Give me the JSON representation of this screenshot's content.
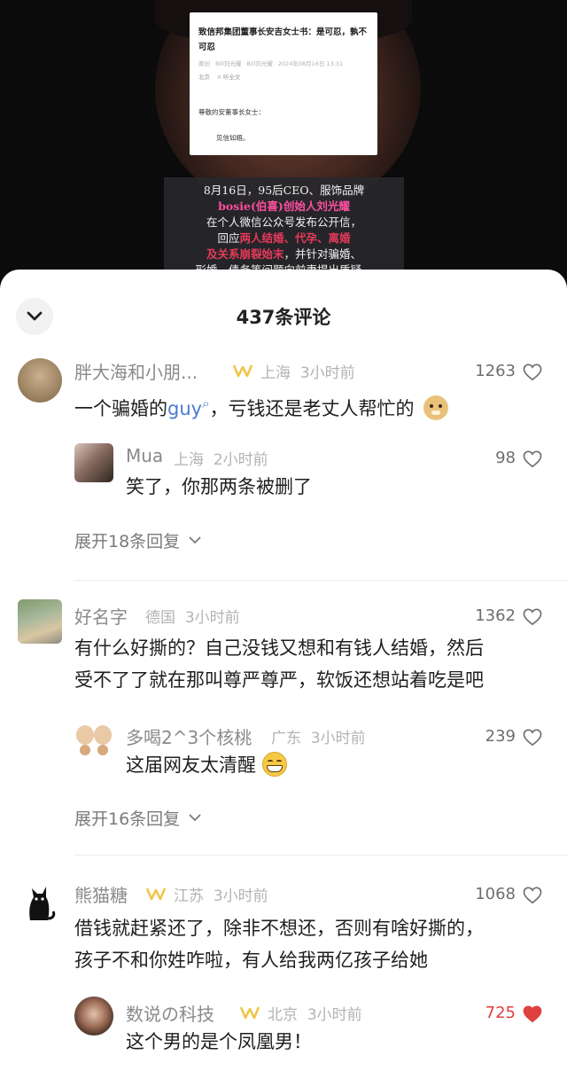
{
  "video": {
    "doc_title": "致信邦集团董事长安吉女士书：是可忍，孰不可忍",
    "doc_meta": [
      "原创",
      "Bill刘光耀",
      "Bill刘光耀",
      "2024年08月16日 13:31"
    ],
    "doc_meta2": [
      "北京",
      "听全文"
    ],
    "doc_greeting": "尊敬的安董事长女士：",
    "doc_body": "见信如晤。",
    "caption_lines": [
      {
        "parts": [
          {
            "t": "8月16日，95后CEO、服饰品牌",
            "c": ""
          }
        ]
      },
      {
        "parts": [
          {
            "t": "bosie(伯喜)创始人刘光耀",
            "c": "pink"
          }
        ]
      },
      {
        "parts": [
          {
            "t": "在个人微信公众号发布公开信，",
            "c": ""
          }
        ]
      },
      {
        "parts": [
          {
            "t": "回应",
            "c": ""
          },
          {
            "t": "两人结婚、代孕、离婚",
            "c": "red"
          }
        ]
      },
      {
        "parts": [
          {
            "t": "及关系崩裂始末",
            "c": "red"
          },
          {
            "t": "，并针对骗婚、",
            "c": ""
          }
        ]
      },
      {
        "parts": [
          {
            "t": "形婚、债务等问题向前妻提出质疑。",
            "c": ""
          }
        ]
      }
    ]
  },
  "sheet": {
    "title": "437条评论"
  },
  "comments": {
    "c1": {
      "user": "胖大海和小朋...",
      "region": "上海",
      "time": "3小时前",
      "likes": "1263",
      "text_a": "一个骗婚的",
      "text_link": "guy",
      "text_b": "，亏钱还是老丈人帮忙的"
    },
    "r1": {
      "user": "Mua",
      "region": "上海",
      "time": "2小时前",
      "likes": "98",
      "text": "笑了，你那两条被删了"
    },
    "e1": "展开18条回复",
    "c2": {
      "user": "好名字",
      "region": "德国",
      "time": "3小时前",
      "likes": "1362",
      "line1": "有什么好撕的？自己没钱又想和有钱人结婚，然后",
      "line2": "受不了了就在那叫尊严尊严，软饭还想站着吃是吧"
    },
    "r2": {
      "user": "多喝2^3个核桃",
      "region": "广东",
      "time": "3小时前",
      "likes": "239",
      "text": "这届网友太清醒"
    },
    "e2": "展开16条回复",
    "c3": {
      "user": "熊猫糖",
      "region": "江苏",
      "time": "3小时前",
      "likes": "1068",
      "line1": "借钱就赶紧还了，除非不想还，否则有啥好撕的，",
      "line2": "孩子不和你姓咋啦，有人给我两亿孩子给她"
    },
    "r3": {
      "user": "数说の科技",
      "region": "北京",
      "time": "3小时前",
      "likes": "725",
      "text": "这个男的是个凤凰男！"
    }
  },
  "colors": {
    "liked": "#e0403f",
    "badge": "#f0c64a",
    "link": "#4a7bd0"
  }
}
